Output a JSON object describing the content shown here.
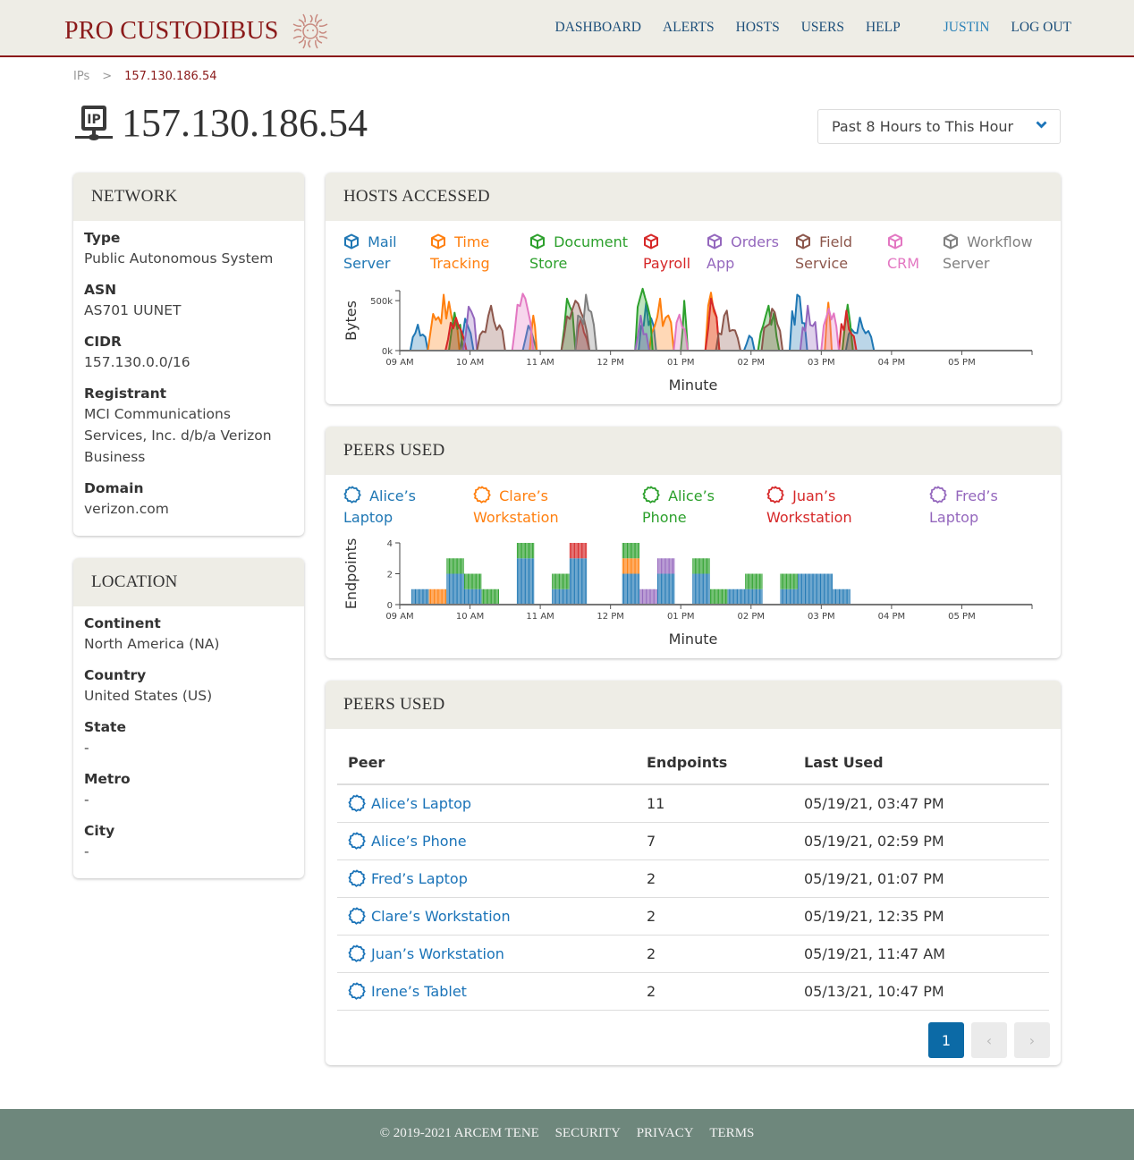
{
  "app": {
    "brand": "PRO CUSTODIBUS"
  },
  "nav": {
    "items": [
      "DASHBOARD",
      "ALERTS",
      "HOSTS",
      "USERS",
      "HELP"
    ],
    "user": "JUSTIN",
    "logout": "LOG OUT"
  },
  "breadcrumb": {
    "parent": "IPs",
    "separator": ">",
    "current": "157.130.186.54"
  },
  "page": {
    "title": "157.130.186.54",
    "icon": "ip-network-icon"
  },
  "range": {
    "selected": "Past 8 Hours to This Hour",
    "icon": "chevron-down-icon"
  },
  "network": {
    "title": "NETWORK",
    "fields": [
      {
        "label": "Type",
        "value": "Public Autonomous System"
      },
      {
        "label": "ASN",
        "value": "AS701 UUNET"
      },
      {
        "label": "CIDR",
        "value": "157.130.0.0/16"
      },
      {
        "label": "Registrant",
        "value": "MCI Communications Services, Inc. d/b/a Verizon Business"
      },
      {
        "label": "Domain",
        "value": "verizon.com"
      }
    ]
  },
  "location": {
    "title": "LOCATION",
    "fields": [
      {
        "label": "Continent",
        "value": "North America (NA)"
      },
      {
        "label": "Country",
        "value": "United States (US)"
      },
      {
        "label": "State",
        "value": "-"
      },
      {
        "label": "Metro",
        "value": "-"
      },
      {
        "label": "City",
        "value": "-"
      }
    ]
  },
  "hosts_accessed": {
    "title": "HOSTS ACCESSED"
  },
  "peers_chart": {
    "title": "PEERS USED"
  },
  "peers_table": {
    "title": "PEERS USED",
    "columns": [
      "Peer",
      "Endpoints",
      "Last Used"
    ],
    "rows": [
      {
        "peer": "Alice’s Laptop",
        "endpoints": "11",
        "last_used": "05/19/21, 03:47 PM"
      },
      {
        "peer": "Alice’s Phone",
        "endpoints": "7",
        "last_used": "05/19/21, 02:59 PM"
      },
      {
        "peer": "Fred’s Laptop",
        "endpoints": "2",
        "last_used": "05/19/21, 01:07 PM"
      },
      {
        "peer": "Clare’s Workstation",
        "endpoints": "2",
        "last_used": "05/19/21, 12:35 PM"
      },
      {
        "peer": "Juan’s Workstation",
        "endpoints": "2",
        "last_used": "05/19/21, 11:47 AM"
      },
      {
        "peer": "Irene’s Tablet",
        "endpoints": "2",
        "last_used": "05/13/21, 10:47 PM"
      }
    ],
    "pagination": {
      "current": "1",
      "prev": "‹",
      "next": "›"
    }
  },
  "footer": {
    "copyright": "© 2019-2021 ARCEM TENE",
    "links": [
      "SECURITY",
      "PRIVACY",
      "TERMS"
    ]
  },
  "chart_data": [
    {
      "type": "area",
      "title": "HOSTS ACCESSED",
      "xlabel": "Minute",
      "ylabel": "Bytes",
      "x_ticks": [
        "09 AM",
        "10 AM",
        "11 AM",
        "12 PM",
        "01 PM",
        "02 PM",
        "03 PM",
        "04 PM",
        "05 PM"
      ],
      "y_ticks": [
        "0k",
        "500k"
      ],
      "xlim_hours": [
        9,
        18
      ],
      "ylim": [
        0,
        600000
      ],
      "legend": "top",
      "series": [
        {
          "name": "Mail Server",
          "color": "#1f77b4",
          "bursts": [
            [
              9.15,
              9.4,
              260000
            ],
            [
              9.85,
              10.05,
              320000
            ],
            [
              10.75,
              10.95,
              250000
            ],
            [
              12.4,
              12.65,
              480000
            ],
            [
              13.9,
              14.05,
              150000
            ],
            [
              14.55,
              14.8,
              560000
            ],
            [
              15.35,
              15.75,
              330000
            ]
          ]
        },
        {
          "name": "Time Tracking",
          "color": "#ff7f0e",
          "bursts": [
            [
              9.4,
              9.85,
              560000
            ],
            [
              10.85,
              10.95,
              350000
            ],
            [
              12.55,
              12.9,
              520000
            ],
            [
              13.35,
              13.55,
              580000
            ],
            [
              15.05,
              15.15,
              480000
            ]
          ]
        },
        {
          "name": "Document Store",
          "color": "#2ca02c",
          "bursts": [
            [
              9.7,
              9.9,
              380000
            ],
            [
              11.3,
              11.5,
              520000
            ],
            [
              12.35,
              12.6,
              620000
            ],
            [
              13.0,
              13.1,
              500000
            ],
            [
              14.1,
              14.4,
              450000
            ],
            [
              15.3,
              15.45,
              460000
            ]
          ]
        },
        {
          "name": "Payroll",
          "color": "#d62728",
          "bursts": [
            [
              9.65,
              9.95,
              330000
            ],
            [
              11.5,
              11.7,
              320000
            ],
            [
              13.35,
              13.55,
              520000
            ],
            [
              15.25,
              15.5,
              400000
            ]
          ]
        },
        {
          "name": "Orders App",
          "color": "#9467bd",
          "bursts": [
            [
              9.9,
              10.1,
              440000
            ],
            [
              12.35,
              12.55,
              350000
            ],
            [
              14.7,
              14.95,
              450000
            ]
          ]
        },
        {
          "name": "Field Service",
          "color": "#8c564b",
          "bursts": [
            [
              10.1,
              10.5,
              450000
            ],
            [
              11.3,
              11.7,
              500000
            ],
            [
              13.5,
              13.85,
              400000
            ],
            [
              14.15,
              14.45,
              420000
            ]
          ]
        },
        {
          "name": "CRM",
          "color": "#e377c2",
          "bursts": [
            [
              10.6,
              10.9,
              570000
            ],
            [
              12.9,
              13.1,
              360000
            ],
            [
              15.0,
              15.25,
              420000
            ]
          ]
        },
        {
          "name": "Workflow Server",
          "color": "#7f7f7f",
          "bursts": [
            [
              11.5,
              11.8,
              560000
            ]
          ]
        }
      ]
    },
    {
      "type": "bar",
      "stacked": true,
      "title": "PEERS USED",
      "xlabel": "Minute",
      "ylabel": "Endpoints",
      "x_ticks": [
        "09 AM",
        "10 AM",
        "11 AM",
        "12 PM",
        "01 PM",
        "02 PM",
        "03 PM",
        "04 PM",
        "05 PM"
      ],
      "y_ticks": [
        "0",
        "2",
        "4"
      ],
      "ylim": [
        0,
        4
      ],
      "legend": "top",
      "series_meta": [
        {
          "name": "Alice’s Laptop",
          "color": "#1f77b4"
        },
        {
          "name": "Clare’s Workstation",
          "color": "#ff7f0e"
        },
        {
          "name": "Alice’s Phone",
          "color": "#2ca02c"
        },
        {
          "name": "Juan’s Workstation",
          "color": "#d62728"
        },
        {
          "name": "Fred’s Laptop",
          "color": "#9467bd"
        }
      ],
      "buckets": [
        {
          "start": "09:10",
          "end": "09:25",
          "values": [
            1,
            0,
            0,
            0,
            0
          ]
        },
        {
          "start": "09:25",
          "end": "09:40",
          "values": [
            0,
            1,
            0,
            0,
            0
          ]
        },
        {
          "start": "09:40",
          "end": "09:55",
          "values": [
            2,
            0,
            1,
            0,
            0
          ]
        },
        {
          "start": "09:55",
          "end": "10:10",
          "values": [
            1,
            0,
            1,
            0,
            0
          ]
        },
        {
          "start": "10:10",
          "end": "10:25",
          "values": [
            0,
            0,
            1,
            0,
            0
          ]
        },
        {
          "start": "10:40",
          "end": "10:55",
          "values": [
            3,
            0,
            1,
            0,
            0
          ]
        },
        {
          "start": "11:10",
          "end": "11:25",
          "values": [
            1,
            0,
            1,
            0,
            0
          ]
        },
        {
          "start": "11:25",
          "end": "11:40",
          "values": [
            3,
            0,
            0,
            1,
            0
          ]
        },
        {
          "start": "12:10",
          "end": "12:25",
          "values": [
            2,
            1,
            1,
            0,
            0
          ]
        },
        {
          "start": "12:25",
          "end": "12:40",
          "values": [
            0,
            0,
            0,
            0,
            1
          ]
        },
        {
          "start": "12:40",
          "end": "12:55",
          "values": [
            2,
            0,
            0,
            0,
            1
          ]
        },
        {
          "start": "13:10",
          "end": "13:25",
          "values": [
            2,
            0,
            1,
            0,
            0
          ]
        },
        {
          "start": "13:25",
          "end": "13:40",
          "values": [
            0,
            0,
            1,
            0,
            0
          ]
        },
        {
          "start": "13:40",
          "end": "13:55",
          "values": [
            1,
            0,
            0,
            0,
            0
          ]
        },
        {
          "start": "13:55",
          "end": "14:10",
          "values": [
            1,
            0,
            1,
            0,
            0
          ]
        },
        {
          "start": "14:25",
          "end": "14:40",
          "values": [
            1,
            0,
            1,
            0,
            0
          ]
        },
        {
          "start": "14:40",
          "end": "14:55",
          "values": [
            2,
            0,
            0,
            0,
            0
          ]
        },
        {
          "start": "14:55",
          "end": "15:10",
          "values": [
            2,
            0,
            0,
            0,
            0
          ]
        },
        {
          "start": "15:10",
          "end": "15:25",
          "values": [
            1,
            0,
            0,
            0,
            0
          ]
        }
      ]
    }
  ]
}
